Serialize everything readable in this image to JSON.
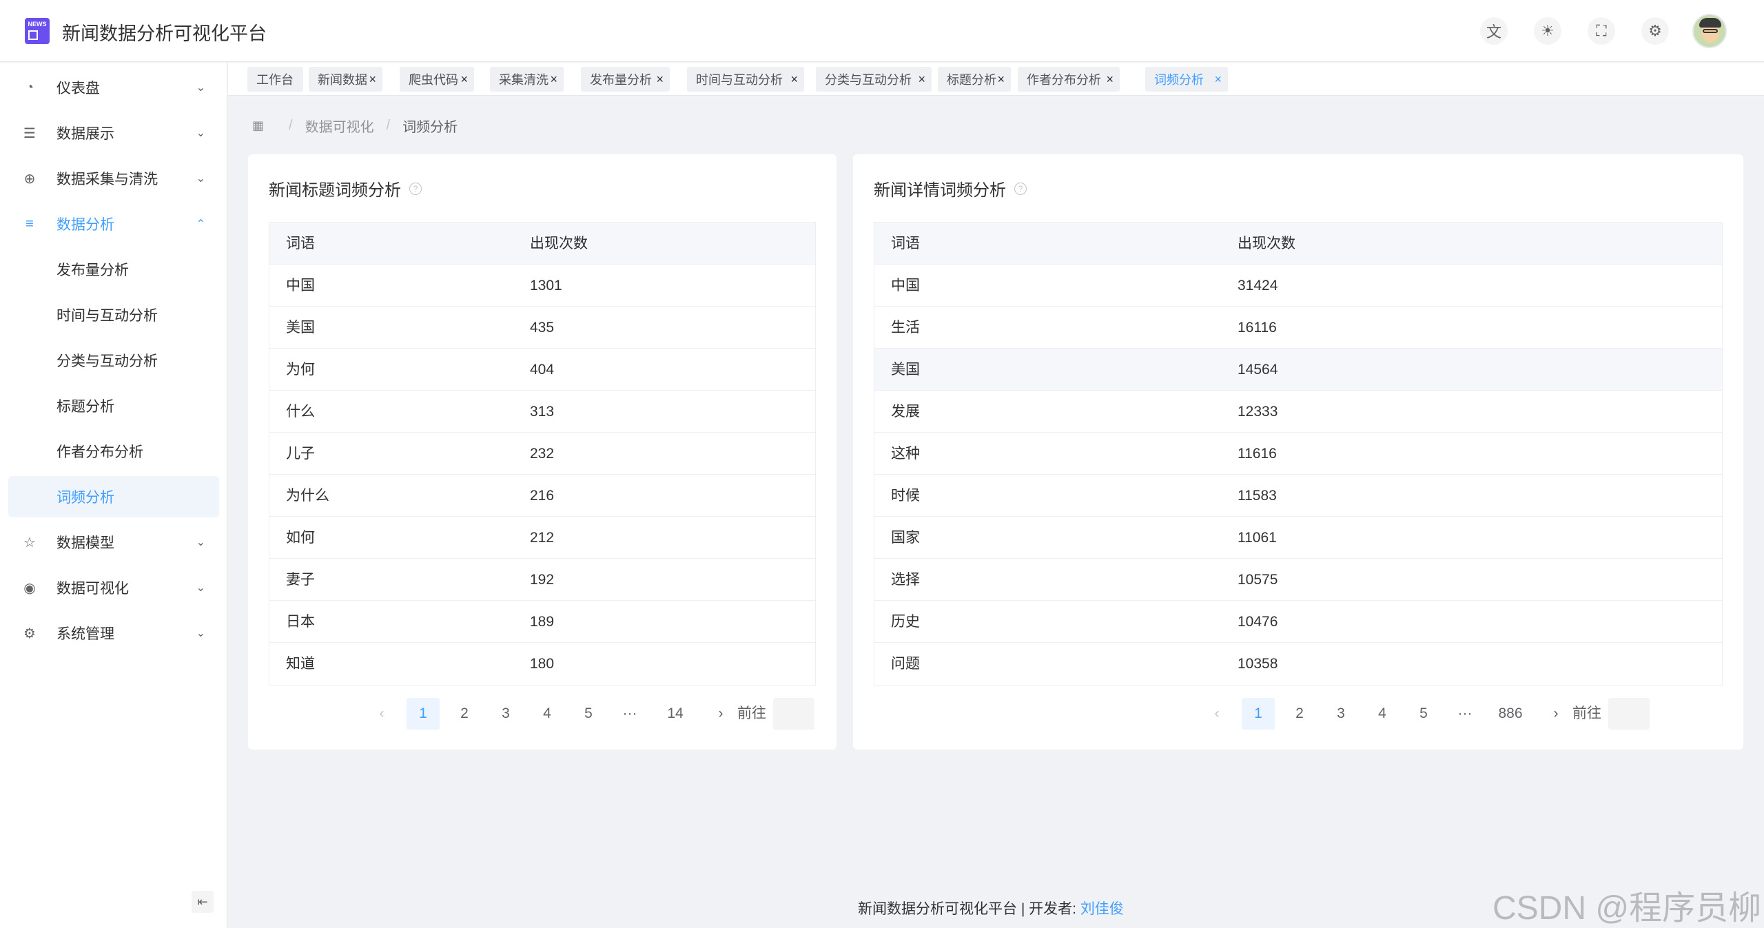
{
  "header": {
    "logo_text": "NEWS",
    "title": "新闻数据分析可视化平台",
    "icons": [
      "translate-icon",
      "theme-icon",
      "fullscreen-icon",
      "settings-icon"
    ]
  },
  "sidebar": {
    "items": [
      {
        "label": "仪表盘",
        "icon": "dashboard-icon"
      },
      {
        "label": "数据展示",
        "icon": "list-icon"
      },
      {
        "label": "数据采集与清洗",
        "icon": "plus-circle-icon"
      },
      {
        "label": "数据分析",
        "icon": "menu-icon"
      },
      {
        "label": "数据模型",
        "icon": "star-icon"
      },
      {
        "label": "数据可视化",
        "icon": "eye-icon"
      },
      {
        "label": "系统管理",
        "icon": "gear-icon"
      }
    ],
    "subitems": [
      "发布量分析",
      "时间与互动分析",
      "分类与互动分析",
      "标题分析",
      "作者分布分析",
      "词频分析"
    ]
  },
  "tabs": [
    "工作台",
    "新闻数据",
    "爬虫代码",
    "采集清洗",
    "发布量分析",
    "时间与互动分析",
    "分类与互动分析",
    "标题分析",
    "作者分布分析",
    "词频分析"
  ],
  "breadcrumb": {
    "parent": "数据可视化",
    "current": "词频分析"
  },
  "left_card": {
    "title": "新闻标题词频分析",
    "columns": [
      "词语",
      "出现次数"
    ],
    "rows": [
      [
        "中国",
        "1301"
      ],
      [
        "美国",
        "435"
      ],
      [
        "为何",
        "404"
      ],
      [
        "什么",
        "313"
      ],
      [
        "儿子",
        "232"
      ],
      [
        "为什么",
        "216"
      ],
      [
        "如何",
        "212"
      ],
      [
        "妻子",
        "192"
      ],
      [
        "日本",
        "189"
      ],
      [
        "知道",
        "180"
      ]
    ],
    "pages": [
      "1",
      "2",
      "3",
      "4",
      "5",
      "···",
      "14"
    ],
    "goto_label": "前往"
  },
  "right_card": {
    "title": "新闻详情词频分析",
    "columns": [
      "词语",
      "出现次数"
    ],
    "rows": [
      [
        "中国",
        "31424"
      ],
      [
        "生活",
        "16116"
      ],
      [
        "美国",
        "14564"
      ],
      [
        "发展",
        "12333"
      ],
      [
        "这种",
        "11616"
      ],
      [
        "时候",
        "11583"
      ],
      [
        "国家",
        "11061"
      ],
      [
        "选择",
        "10575"
      ],
      [
        "历史",
        "10476"
      ],
      [
        "问题",
        "10358"
      ]
    ],
    "pages": [
      "1",
      "2",
      "3",
      "4",
      "5",
      "···",
      "886"
    ],
    "goto_label": "前往"
  },
  "footer": {
    "text": "新闻数据分析可视化平台 | 开发者:",
    "author": "刘佳俊"
  },
  "watermark": "CSDN @程序员柳",
  "colors": {
    "accent": "#409eff",
    "logo": "#6b4ef0"
  }
}
